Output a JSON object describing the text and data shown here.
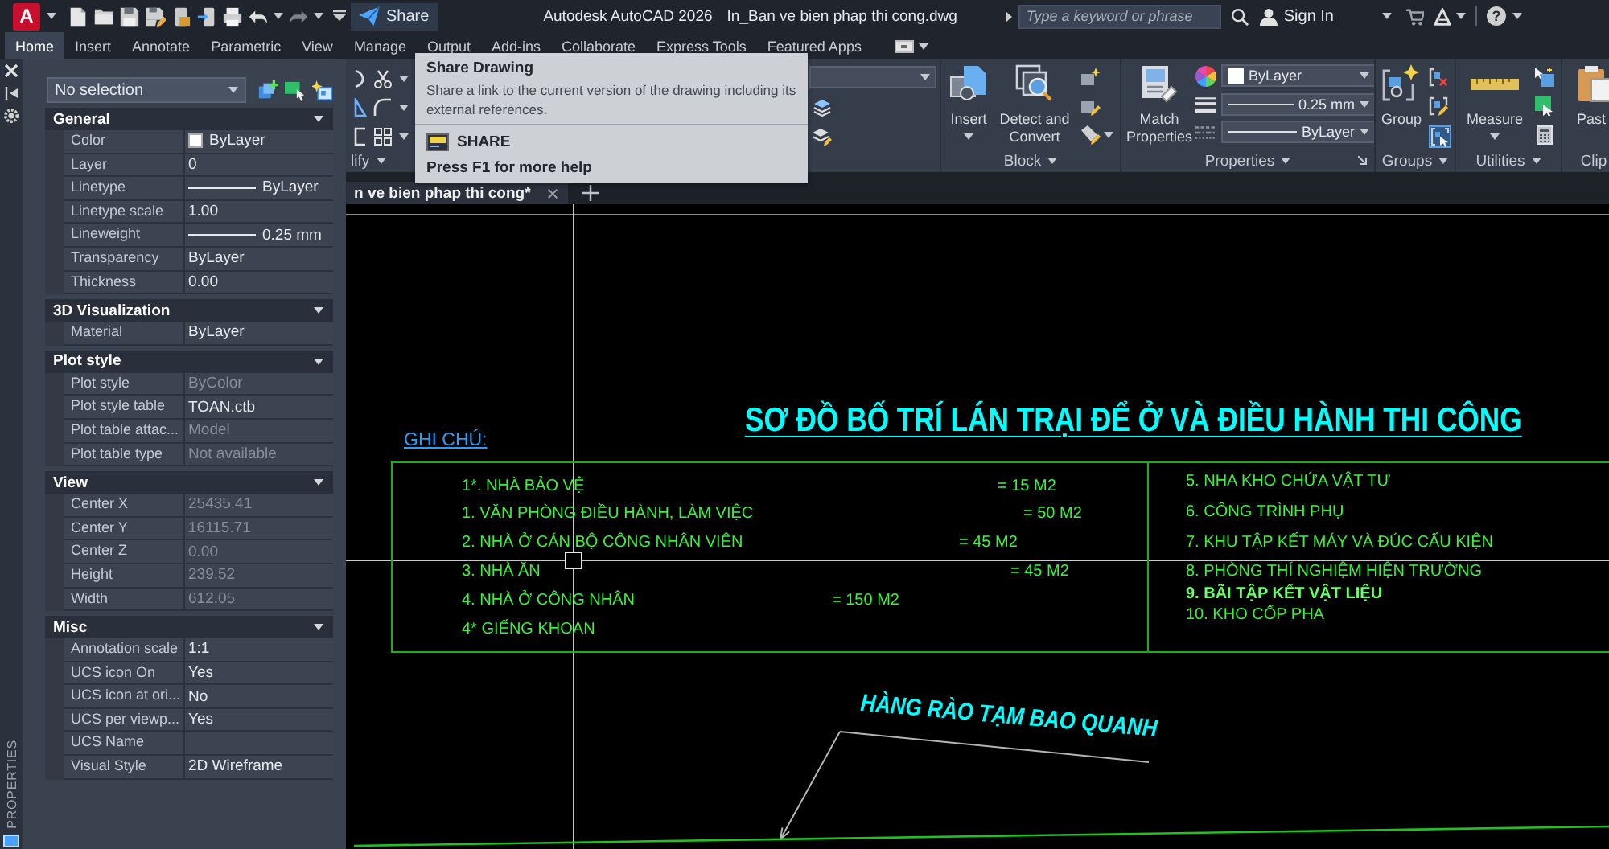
{
  "title_bar": {
    "app_button": "A",
    "share_button": "Share",
    "app_name": "Autodesk AutoCAD 2026",
    "file_name": "In_Ban ve bien phap thi cong.dwg",
    "search": {
      "placeholder": "Type a keyword or phrase"
    },
    "sign_in": "Sign In",
    "help_button": "?"
  },
  "ribbon": {
    "tabs": [
      {
        "label": "Home",
        "selected": true
      },
      {
        "label": "Insert",
        "selected": false
      },
      {
        "label": "Annotate",
        "selected": false
      },
      {
        "label": "Parametric",
        "selected": false
      },
      {
        "label": "View",
        "selected": false
      },
      {
        "label": "Manage",
        "selected": false
      },
      {
        "label": "Output",
        "selected": false
      },
      {
        "label": "Add-ins",
        "selected": false
      },
      {
        "label": "Collaborate",
        "selected": false
      },
      {
        "label": "Express Tools",
        "selected": false
      },
      {
        "label": "Featured Apps",
        "selected": false
      }
    ],
    "modify_panel": {
      "label": "lify"
    },
    "block_panel": {
      "label": "Block",
      "insert_button": "Insert",
      "detect_button": "Detect and Convert"
    },
    "properties_panel": {
      "label": "Properties",
      "match_button": "Match Properties",
      "color_value": "ByLayer",
      "lineweight": "0.25 mm",
      "linetype": "ByLayer"
    },
    "groups_panel": {
      "label": "Groups",
      "group_button": "Group",
      "group_selection": {
        "on": true
      }
    },
    "utilities_panel": {
      "label": "Utilities",
      "measure_button": "Measure"
    },
    "clipboard_panel": {
      "label": "Clip",
      "paste_button": "Past"
    }
  },
  "tooltip": {
    "title": "Share Drawing",
    "description": "Share a link to the current version of the drawing including its external references.",
    "command": "SHARE",
    "help": "Press F1 for more help"
  },
  "properties_palette": {
    "title": "PROPERTIES",
    "selection": "No selection",
    "sections": [
      {
        "title": "General",
        "expanded": true,
        "rows": [
          {
            "label": "Color",
            "value": "ByLayer",
            "kind": "color",
            "disabled": false
          },
          {
            "label": "Layer",
            "value": "0",
            "kind": "text",
            "disabled": false
          },
          {
            "label": "Linetype",
            "value": "ByLayer",
            "kind": "line",
            "disabled": false
          },
          {
            "label": "Linetype scale",
            "value": "1.00",
            "kind": "text",
            "disabled": false
          },
          {
            "label": "Lineweight",
            "value": "0.25 mm",
            "kind": "line",
            "disabled": false
          },
          {
            "label": "Transparency",
            "value": "ByLayer",
            "kind": "text",
            "disabled": false
          },
          {
            "label": "Thickness",
            "value": "0.00",
            "kind": "text",
            "disabled": false
          }
        ]
      },
      {
        "title": "3D Visualization",
        "expanded": true,
        "rows": [
          {
            "label": "Material",
            "value": "ByLayer",
            "kind": "text",
            "disabled": false
          }
        ]
      },
      {
        "title": "Plot style",
        "expanded": true,
        "rows": [
          {
            "label": "Plot style",
            "value": "ByColor",
            "kind": "text",
            "disabled": true
          },
          {
            "label": "Plot style table",
            "value": "TOAN.ctb",
            "kind": "text",
            "disabled": false
          },
          {
            "label": "Plot table attac...",
            "value": "Model",
            "kind": "text",
            "disabled": true
          },
          {
            "label": "Plot table type",
            "value": "Not available",
            "kind": "text",
            "disabled": true
          }
        ]
      },
      {
        "title": "View",
        "expanded": true,
        "rows": [
          {
            "label": "Center X",
            "value": "25435.41",
            "kind": "text",
            "disabled": true
          },
          {
            "label": "Center Y",
            "value": "16115.71",
            "kind": "text",
            "disabled": true
          },
          {
            "label": "Center Z",
            "value": "0.00",
            "kind": "text",
            "disabled": true
          },
          {
            "label": "Height",
            "value": "239.52",
            "kind": "text",
            "disabled": true
          },
          {
            "label": "Width",
            "value": "612.05",
            "kind": "text",
            "disabled": true
          }
        ]
      },
      {
        "title": "Misc",
        "expanded": true,
        "rows": [
          {
            "label": "Annotation scale",
            "value": "1:1",
            "kind": "text",
            "disabled": false
          },
          {
            "label": "UCS icon On",
            "value": "Yes",
            "kind": "text",
            "disabled": false
          },
          {
            "label": "UCS icon at ori...",
            "value": "No",
            "kind": "text",
            "disabled": false
          },
          {
            "label": "UCS per viewp...",
            "value": "Yes",
            "kind": "text",
            "disabled": false
          },
          {
            "label": "UCS Name",
            "kind": "text"
          },
          {
            "label": "Visual Style",
            "value": "2D Wireframe",
            "kind": "text",
            "disabled": false
          }
        ]
      }
    ]
  },
  "document_tabs": [
    {
      "label": "n ve bien phap thi cong*",
      "selected": true
    }
  ],
  "drawing": {
    "title": "SƠ ĐỒ BỐ TRÍ LÁN TRẠI ĐỂ Ở VÀ ĐIỀU HÀNH THI CÔNG",
    "legend_heading": "GHI CHÚ:",
    "legend_left": [
      {
        "label": "1*. NHÀ BẢO VỆ",
        "area": "= 15 M2"
      },
      {
        "label": "1. VĂN PHÒNG ĐIỀU HÀNH, LÀM VIỆC",
        "area": "= 50 M2"
      },
      {
        "label": "2. NHÀ Ở CÁN BỘ CÔNG NHÂN VIÊN",
        "area": "= 45 M2"
      },
      {
        "label": "3. NHÀ ĂN",
        "area": "= 45 M2"
      },
      {
        "label": "4. NHÀ Ở CÔNG NHÂN",
        "area": "= 150 M2"
      },
      {
        "label": "4* GIẾNG KHOAN"
      }
    ],
    "legend_right": [
      {
        "label": "5. NHA KHO CHỨA VẬT TƯ",
        "bold": false
      },
      {
        "label": "6. CÔNG TRÌNH PHỤ",
        "bold": false
      },
      {
        "label": "7. KHU TẬP KẾT MÁY VÀ ĐÚC CẤU KIỆN",
        "bold": false
      },
      {
        "label": "8. PHÒNG THÍ NGHIỆM HIỆN TRƯỜNG",
        "bold": false
      },
      {
        "label": "9. BÃI TẬP KẾT VẬT LIỆU",
        "bold": true
      },
      {
        "label": "10. KHO CỐP PHA",
        "bold": false
      }
    ],
    "fence_label": "HÀNG RÀO TẠM BAO QUANH"
  }
}
